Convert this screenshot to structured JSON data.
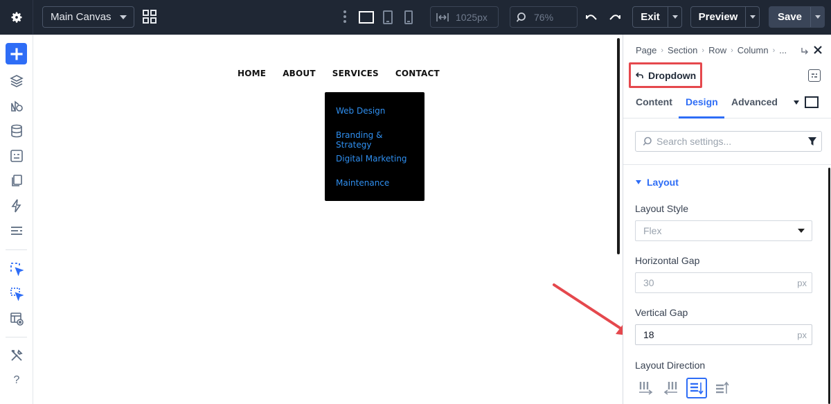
{
  "topbar": {
    "canvas_select": "Main Canvas",
    "width_value": "1025px",
    "zoom_value": "76%",
    "exit_label": "Exit",
    "preview_label": "Preview",
    "save_label": "Save"
  },
  "canvas": {
    "nav": [
      "HOME",
      "ABOUT",
      "SERVICES",
      "CONTACT"
    ],
    "dropdown_items": [
      "Web Design",
      "Branding & Strategy",
      "Digital Marketing",
      "Maintenance"
    ]
  },
  "panel": {
    "breadcrumb": [
      "Page",
      "Section",
      "Row",
      "Column",
      "..."
    ],
    "module_title": "Dropdown",
    "tabs": [
      "Content",
      "Design",
      "Advanced"
    ],
    "active_tab": "Design",
    "search_placeholder": "Search settings...",
    "section_title": "Layout",
    "layout_style_label": "Layout Style",
    "layout_style_value": "Flex",
    "horizontal_gap_label": "Horizontal Gap",
    "horizontal_gap_value": "30",
    "horizontal_gap_unit": "px",
    "vertical_gap_label": "Vertical Gap",
    "vertical_gap_value": "18",
    "vertical_gap_unit": "px",
    "layout_direction_label": "Layout Direction"
  },
  "colors": {
    "topbar_bg": "#1f2734",
    "accent": "#2e6df6",
    "highlight": "#e5484d",
    "dropdown_bg": "#000000",
    "dropdown_link": "#2f8ff0"
  }
}
